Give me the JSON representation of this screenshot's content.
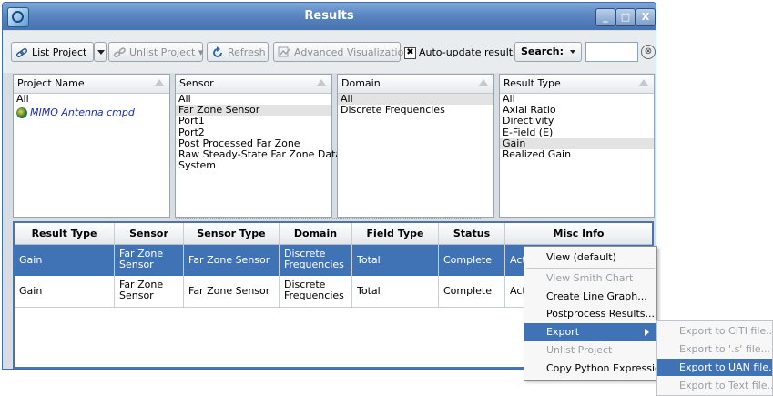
{
  "window": {
    "title": "Results"
  },
  "window_controls": {
    "minimize": "_",
    "maximize": "□",
    "close": "X"
  },
  "toolbar": {
    "list_project": "List Project",
    "unlist_project": "Unlist Project",
    "unlist_caret": "▾",
    "refresh": "Refresh",
    "advanced_visualization": "Advanced Visualization",
    "auto_update_checked": "✖",
    "auto_update_label": "Auto-update results",
    "search_label": "Search:",
    "search_value": "",
    "clear_glyph": "⊗"
  },
  "filters": {
    "project": {
      "header": "Project Name",
      "items": [
        "All",
        "MIMO Antenna cmpd"
      ]
    },
    "sensor": {
      "header": "Sensor",
      "items": [
        "All",
        "Far Zone Sensor",
        "Port1",
        "Port2",
        "Post Processed Far Zone",
        "Raw Steady-State Far Zone Data",
        "System"
      ],
      "selected": 1
    },
    "domain": {
      "header": "Domain",
      "items": [
        "All",
        "Discrete Frequencies"
      ],
      "selected": 0
    },
    "result_type": {
      "header": "Result Type",
      "items": [
        "All",
        "Axial Ratio",
        "Directivity",
        "E-Field (E)",
        "Gain",
        "Realized Gain"
      ],
      "selected": 4
    }
  },
  "grid": {
    "columns": [
      "Result Type",
      "Sensor",
      "Sensor Type",
      "Domain",
      "Field Type",
      "Status",
      "Misc Info"
    ],
    "rows": [
      {
        "result_type": "Gain",
        "sensor_l1": "Far Zone",
        "sensor_l2": "Sensor",
        "sensor_type": "Far Zone Sensor",
        "domain_l1": "Discrete",
        "domain_l2": "Frequencies",
        "field_type": "Total",
        "status": "Complete",
        "misc": "Acti"
      },
      {
        "result_type": "Gain",
        "sensor_l1": "Far Zone",
        "sensor_l2": "Sensor",
        "sensor_type": "Far Zone Sensor",
        "domain_l1": "Discrete",
        "domain_l2": "Frequencies",
        "field_type": "Total",
        "status": "Complete",
        "misc": "Acti"
      }
    ]
  },
  "context_menu": {
    "view_default": "View (default)",
    "view_smith": "View Smith Chart",
    "create_line_graph": "Create Line Graph...",
    "postprocess": "Postprocess Results...",
    "export": "Export",
    "unlist_project": "Unlist Project",
    "copy_python": "Copy Python Expression"
  },
  "export_submenu": {
    "citi": "Export to CITI file...",
    "s_file": "Export to '.s' file...",
    "uan": "Export to UAN file...",
    "text": "Export to Text file..."
  },
  "colors": {
    "selection": "#3f73b5",
    "titlebar": "#5b86c1"
  }
}
